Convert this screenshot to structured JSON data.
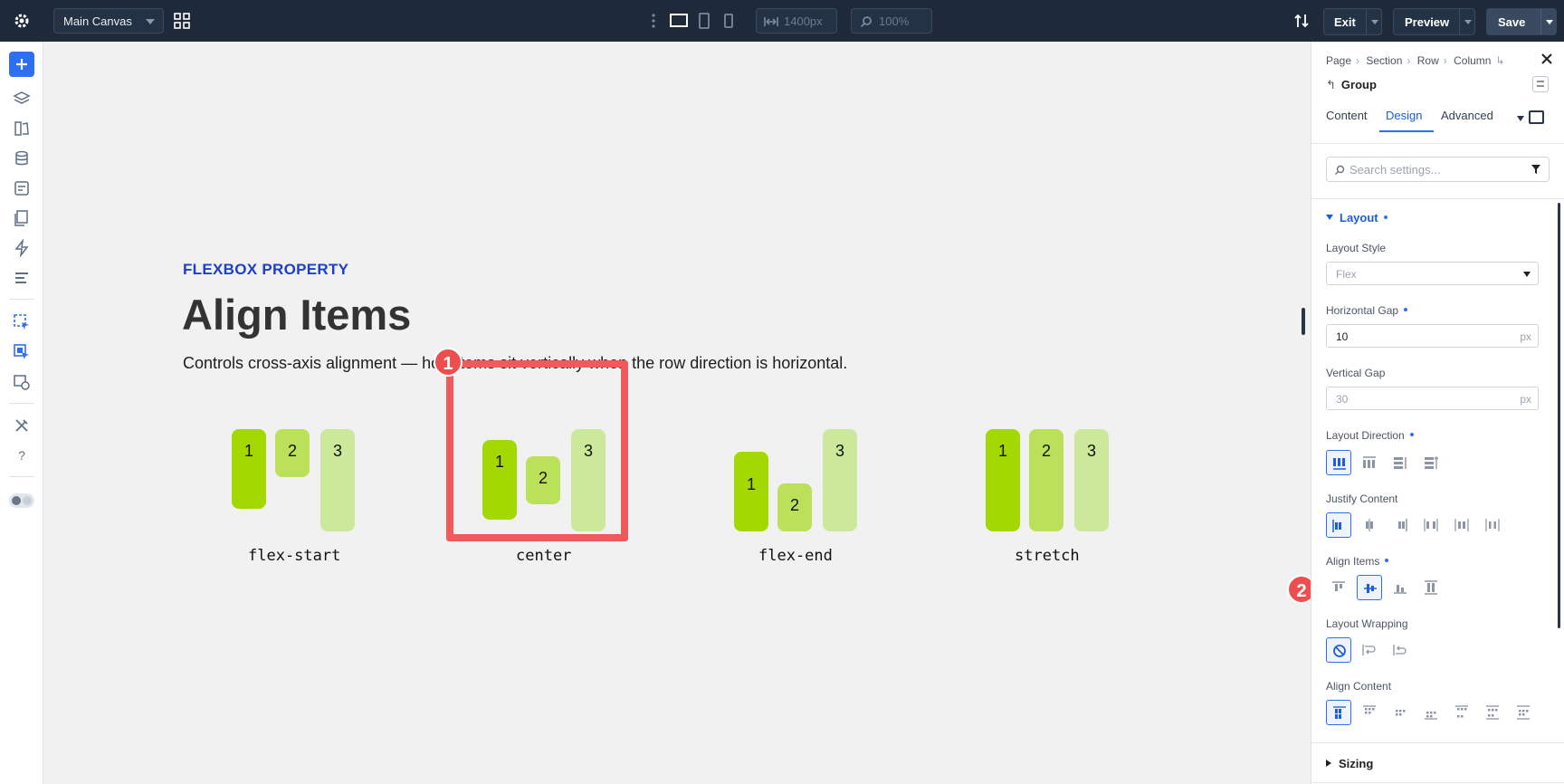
{
  "topbar": {
    "canvas_name": "Main Canvas",
    "width_value": "1400px",
    "zoom_value": "100%",
    "exit_label": "Exit",
    "preview_label": "Preview",
    "save_label": "Save"
  },
  "canvas": {
    "eyebrow": "FLEXBOX PROPERTY",
    "title": "Align Items",
    "lead": "Controls cross-axis alignment — how items sit vertically when the row direction is horizontal.",
    "demos": [
      {
        "label": "flex-start",
        "items": [
          "1",
          "2",
          "3"
        ]
      },
      {
        "label": "center",
        "items": [
          "1",
          "2",
          "3"
        ]
      },
      {
        "label": "flex-end",
        "items": [
          "1",
          "2",
          "3"
        ]
      },
      {
        "label": "stretch",
        "items": [
          "1",
          "2",
          "3"
        ]
      }
    ],
    "badge_1": "1",
    "badge_2": "2"
  },
  "panel": {
    "breadcrumb": [
      "Page",
      "Section",
      "Row",
      "Column"
    ],
    "element_name": "Group",
    "tabs": [
      "Content",
      "Design",
      "Advanced"
    ],
    "active_tab": "Design",
    "search_placeholder": "Search settings...",
    "layout_section": "Layout",
    "layout_style_label": "Layout Style",
    "layout_style_value": "Flex",
    "horizontal_gap_label": "Horizontal Gap",
    "horizontal_gap_value": "10",
    "horizontal_gap_unit": "px",
    "vertical_gap_label": "Vertical Gap",
    "vertical_gap_placeholder": "30",
    "vertical_gap_unit": "px",
    "layout_direction_label": "Layout Direction",
    "justify_content_label": "Justify Content",
    "align_items_label": "Align Items",
    "layout_wrapping_label": "Layout Wrapping",
    "align_content_label": "Align Content",
    "sizing_section": "Sizing"
  },
  "colors": {
    "accent": "#2e6ff2",
    "highlight": "#ef5a5a",
    "item_1": "#a3d900",
    "item_2": "#bbe05a",
    "item_3": "#cce89a"
  }
}
